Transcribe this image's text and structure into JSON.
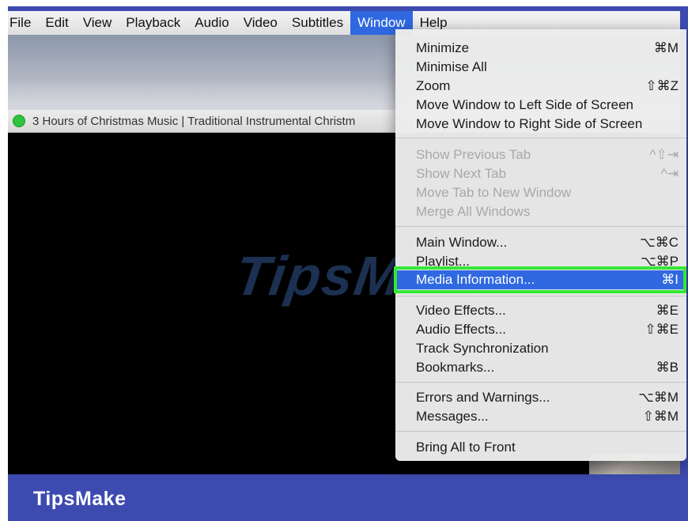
{
  "menubar": {
    "items": [
      "File",
      "Edit",
      "View",
      "Playback",
      "Audio",
      "Video",
      "Subtitles",
      "Window",
      "Help"
    ],
    "active": "Window"
  },
  "player": {
    "title": "3 Hours of Christmas Music | Traditional Instrumental Christm"
  },
  "watermark": "TipsMake",
  "brand": "TipsMake",
  "window_menu": {
    "items": [
      {
        "label": "Minimize",
        "shortcut": "⌘M",
        "enabled": true
      },
      {
        "label": "Minimise All",
        "shortcut": "",
        "enabled": true
      },
      {
        "label": "Zoom",
        "shortcut": "⇧⌘Z",
        "enabled": true
      },
      {
        "label": "Move Window to Left Side of Screen",
        "shortcut": "",
        "enabled": true
      },
      {
        "label": "Move Window to Right Side of Screen",
        "shortcut": "",
        "enabled": true
      },
      {
        "label": "Show Previous Tab",
        "shortcut": "^⇧⇥",
        "enabled": false
      },
      {
        "label": "Show Next Tab",
        "shortcut": "^⇥",
        "enabled": false
      },
      {
        "label": "Move Tab to New Window",
        "shortcut": "",
        "enabled": false
      },
      {
        "label": "Merge All Windows",
        "shortcut": "",
        "enabled": false
      },
      {
        "label": "Main Window...",
        "shortcut": "⌥⌘C",
        "enabled": true
      },
      {
        "label": "Playlist...",
        "shortcut": "⌥⌘P",
        "enabled": true
      },
      {
        "label": "Media Information...",
        "shortcut": "⌘I",
        "enabled": true,
        "highlighted": true
      },
      {
        "label": "Video Effects...",
        "shortcut": "⌘E",
        "enabled": true
      },
      {
        "label": "Audio Effects...",
        "shortcut": "⇧⌘E",
        "enabled": true
      },
      {
        "label": "Track Synchronization",
        "shortcut": "",
        "enabled": true
      },
      {
        "label": "Bookmarks...",
        "shortcut": "⌘B",
        "enabled": true
      },
      {
        "label": "Errors and Warnings...",
        "shortcut": "⌥⌘M",
        "enabled": true
      },
      {
        "label": "Messages...",
        "shortcut": "⇧⌘M",
        "enabled": true
      },
      {
        "label": "Bring All to Front",
        "shortcut": "",
        "enabled": true
      }
    ]
  },
  "colors": {
    "frame": "#3d4bb0",
    "menu_highlight": "#2f68e0",
    "callout_box": "#35e835"
  }
}
